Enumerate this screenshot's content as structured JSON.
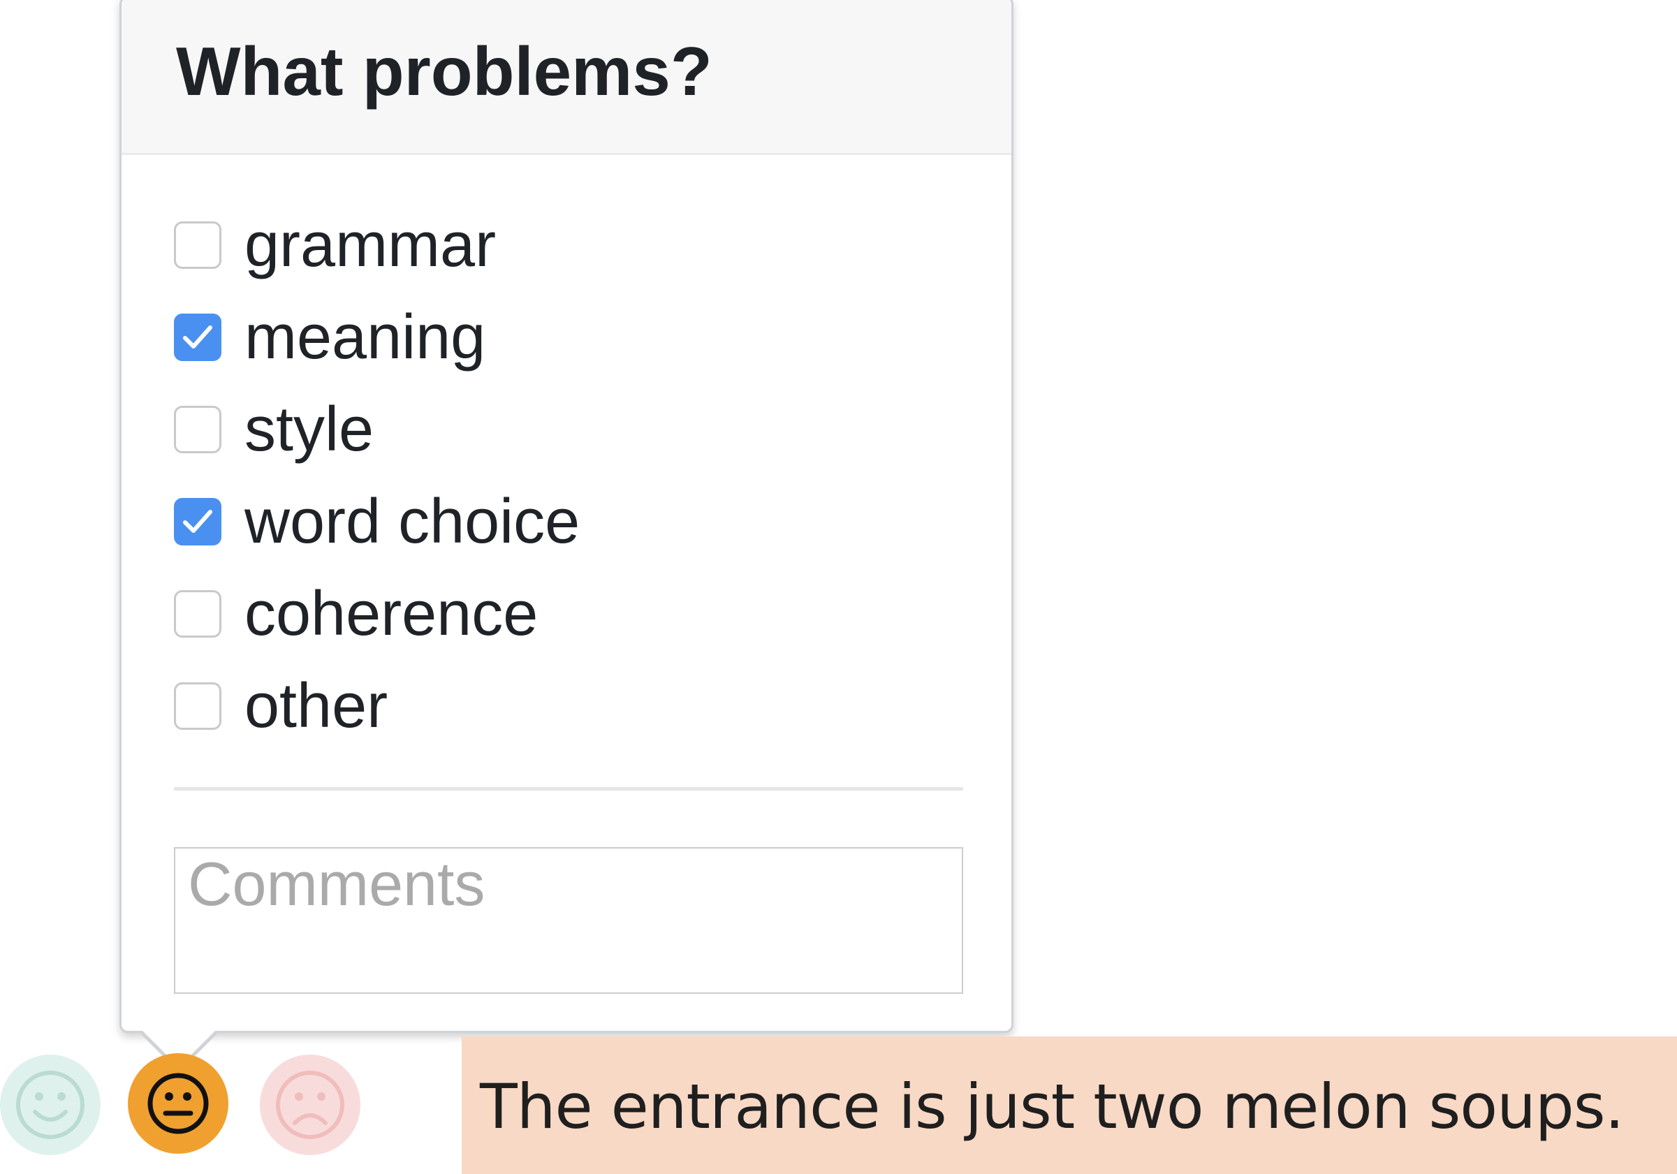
{
  "popover": {
    "title": "What problems?",
    "options": [
      {
        "label": "grammar",
        "checked": false
      },
      {
        "label": "meaning",
        "checked": true
      },
      {
        "label": "style",
        "checked": false
      },
      {
        "label": "word choice",
        "checked": true
      },
      {
        "label": "coherence",
        "checked": false
      },
      {
        "label": "other",
        "checked": false
      }
    ],
    "comments": {
      "placeholder": "Comments",
      "value": ""
    }
  },
  "rating": {
    "faces": [
      {
        "icon": "smiley-face-icon",
        "state": "inactive",
        "color": "#dff1ec"
      },
      {
        "icon": "neutral-face-icon",
        "state": "selected",
        "color": "#f0a02f"
      },
      {
        "icon": "frowning-face-icon",
        "state": "inactive",
        "color": "#f8dcdb"
      }
    ]
  },
  "sentence": {
    "text": "The entrance is just two melon soups.",
    "highlight_color": "#f8d9c5"
  },
  "colors": {
    "checkbox_checked": "#4a90f0"
  }
}
